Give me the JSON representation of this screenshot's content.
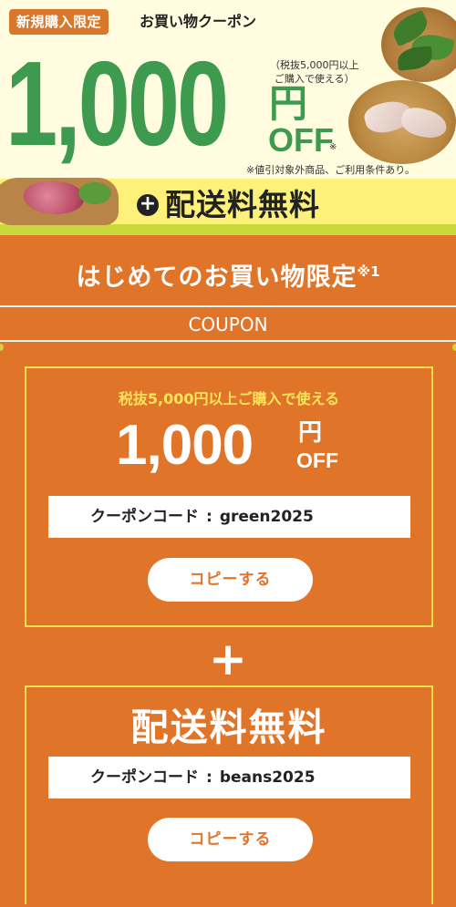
{
  "hero": {
    "badge": "新規購入限定",
    "title": "お買い物クーポン",
    "amount": "1,000",
    "yen": "円",
    "off": "OFF",
    "off_note": "※",
    "condition_line1": "（税抜5,000円以上",
    "condition_line2": "ご購入で使える）",
    "disclaimer": "※値引対象外商品、ご利用条件あり。",
    "plus": "+",
    "free_shipping": "配送料無料"
  },
  "section": {
    "heading": "はじめてのお買い物限定",
    "heading_mark": "※1",
    "coupon_label": "COUPON"
  },
  "coupon1": {
    "condition": "税抜5,000円以上ご購入で使える",
    "amount": "1,000",
    "yen": "円",
    "off": "OFF",
    "code_label": "クーポンコード",
    "code_sep": ":",
    "code": "green2025",
    "copy_label": "コピーする"
  },
  "plus_sign": "+",
  "coupon2": {
    "title": "配送料無料",
    "code_label": "クーポンコード",
    "code_sep": ":",
    "code": "beans2025",
    "copy_label": "コピーする"
  },
  "colors": {
    "orange": "#e0752a",
    "green": "#3e9a4e",
    "yellow": "#f4e04a",
    "hero_bg": "#fffce0"
  }
}
